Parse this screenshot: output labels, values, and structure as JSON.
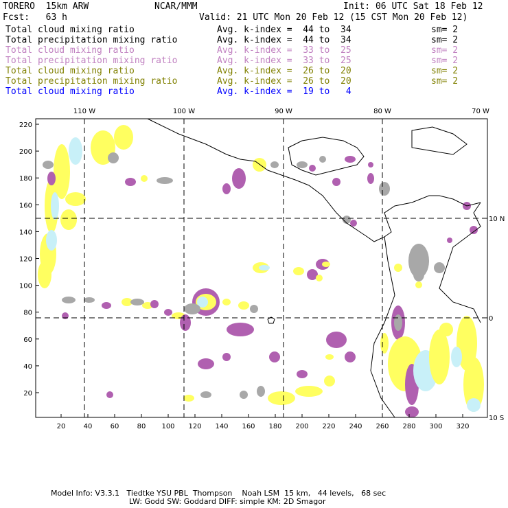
{
  "header": {
    "model": "TORERO  15km ARW",
    "org": "NCAR/MMM",
    "init": "Init: 06 UTC Sat 18 Feb 12",
    "fcst": "Fcst:   63 h",
    "valid": "Valid: 21 UTC Mon 20 Feb 12 (15 CST Mon 20 Feb 12)"
  },
  "legend": [
    {
      "field": "Total cloud mixing ratio",
      "range": "Avg. k-index =  44 to  34",
      "sm": "sm= 2",
      "color": "#000000"
    },
    {
      "field": "Total precipitation mixing ratio",
      "range": "Avg. k-index =  44 to  34",
      "sm": "sm= 2",
      "color": "#000000"
    },
    {
      "field": "Total cloud mixing ratio",
      "range": "Avg. k-index =  33 to  25",
      "sm": "sm= 2",
      "color": "#c080c0"
    },
    {
      "field": "Total precipitation mixing ratio",
      "range": "Avg. k-index =  33 to  25",
      "sm": "sm= 2",
      "color": "#c080c0"
    },
    {
      "field": "Total cloud mixing ratio",
      "range": "Avg. k-index =  26 to  20",
      "sm": "sm= 2",
      "color": "#808000"
    },
    {
      "field": "Total precipitation mixing ratio",
      "range": "Avg. k-index =  26 to  20",
      "sm": "sm= 2",
      "color": "#808000"
    },
    {
      "field": "Total cloud mixing ratio",
      "range": "Avg. k-index =  19 to   4",
      "sm": "",
      "color": "#0000ff"
    }
  ],
  "map": {
    "lon_labels": [
      "110 W",
      "100 W",
      "90 W",
      "80 W",
      "70 W"
    ],
    "lat_labels": [
      "10 N",
      "0",
      "10 S"
    ],
    "x_ticks": [
      "20",
      "40",
      "60",
      "80",
      "100",
      "120",
      "140",
      "160",
      "180",
      "200",
      "220",
      "240",
      "260",
      "280",
      "300",
      "320"
    ],
    "y_ticks": [
      "20",
      "40",
      "60",
      "80",
      "100",
      "120",
      "140",
      "160",
      "180",
      "200",
      "220"
    ],
    "colors": {
      "gray": "#a8a8a8",
      "purple": "#b060b0",
      "yellow": "#ffff60",
      "lightblue": "#c8f0f8"
    }
  },
  "footer": {
    "line1": "Model Info: V3.3.1   Tiedtke YSU PBL  Thompson    Noah LSM  15 km,   44 levels,   68 sec",
    "line2": "LW: Godd SW: Goddard DIFF: simple KM: 2D Smagor"
  }
}
